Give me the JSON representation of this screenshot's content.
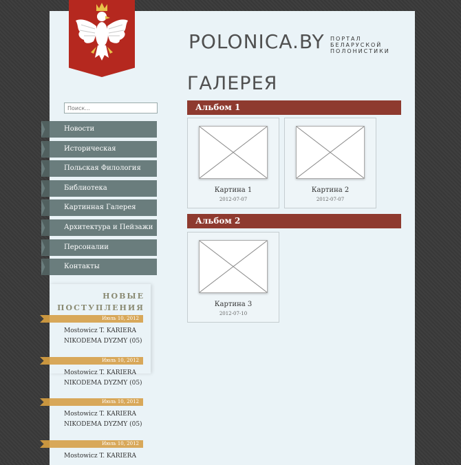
{
  "header": {
    "site_title": "POLONICA.BY",
    "tagline": "ПОРТАЛ БЕЛАРУСКОЙ ПОЛОНИСТИКИ",
    "page_title": "ГАЛЕРЕЯ"
  },
  "search": {
    "placeholder": "Поиск..."
  },
  "nav": {
    "items": [
      {
        "label": "Новости"
      },
      {
        "label": "Историческая Полонистика"
      },
      {
        "label": "Польская Филология"
      },
      {
        "label": "Библиотека"
      },
      {
        "label": "Картинная Галерея"
      },
      {
        "label": "Архитектура и Пейзажи"
      },
      {
        "label": "Персоналии"
      },
      {
        "label": "Контакты"
      }
    ]
  },
  "sidebar": {
    "new_title_line1": "НОВЫЕ",
    "new_title_line2": "ПОСТУПЛЕНИЯ",
    "posts": [
      {
        "date": "Июль 10, 2012",
        "line1": "Mostowicz T. KARIERA",
        "line2": "NIKODEMA DYZMY (05)"
      },
      {
        "date": "Июль 10, 2012",
        "line1": "Mostowicz T. KARIERA",
        "line2": "NIKODEMA DYZMY (05)"
      },
      {
        "date": "Июль 10, 2012",
        "line1": "Mostowicz T. KARIERA",
        "line2": "NIKODEMA DYZMY (05)"
      },
      {
        "date": "Июль 10, 2012",
        "line1": "Mostowicz T. KARIERA",
        "line2": ""
      }
    ]
  },
  "albums": [
    {
      "title": "Альбом 1",
      "pictures": [
        {
          "title": "Картина 1",
          "date": "2012-07-07"
        },
        {
          "title": "Картина 2",
          "date": "2012-07-07"
        }
      ]
    },
    {
      "title": "Альбом 2",
      "pictures": [
        {
          "title": "Картина 3",
          "date": "2012-07-10"
        }
      ]
    }
  ],
  "colors": {
    "album_bar": "#8e3a2f",
    "nav_bg": "#6a7d7d",
    "date_bar": "#d8a85a",
    "emblem": "#b5281f"
  },
  "icons": {
    "emblem": "white-eagle-coat-of-arms",
    "thumb": "image-placeholder-icon"
  }
}
